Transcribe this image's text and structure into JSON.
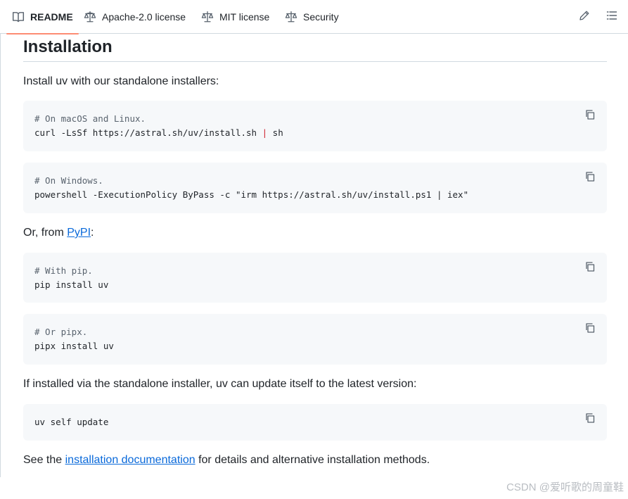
{
  "tabs": [
    {
      "label": "README",
      "icon": "book-icon"
    },
    {
      "label": "Apache-2.0 license",
      "icon": "scale-icon"
    },
    {
      "label": "MIT license",
      "icon": "scale-icon"
    },
    {
      "label": "Security",
      "icon": "scale-icon"
    }
  ],
  "tools": {
    "edit_icon": "pencil-icon",
    "outline_icon": "list-icon"
  },
  "heading": "Installation",
  "intro": "Install uv with our standalone installers:",
  "code1": {
    "comment": "# On macOS and Linux.",
    "cmd_a": "curl -LsSf https://astral.sh/uv/install.sh ",
    "pipe": "|",
    "cmd_b": " sh"
  },
  "code2": {
    "comment": "# On Windows.",
    "cmd": "powershell -ExecutionPolicy ByPass -c \"irm https://astral.sh/uv/install.ps1 | iex\""
  },
  "pypi_line": {
    "prefix": "Or, from ",
    "link": "PyPI",
    "suffix": ":"
  },
  "code3": {
    "comment": "# With pip.",
    "cmd": "pip install uv"
  },
  "code4": {
    "comment": "# Or pipx.",
    "cmd": "pipx install uv"
  },
  "update_line": "If installed via the standalone installer, uv can update itself to the latest version:",
  "code5": {
    "cmd": "uv self update"
  },
  "docs_line": {
    "prefix": "See the ",
    "link": "installation documentation",
    "suffix": " for details and alternative installation methods."
  },
  "watermark": "CSDN @爱听歌的周童鞋",
  "colors": {
    "accent_underline": "#fd8c73",
    "link": "#0969da",
    "code_bg": "#f6f8fa"
  }
}
